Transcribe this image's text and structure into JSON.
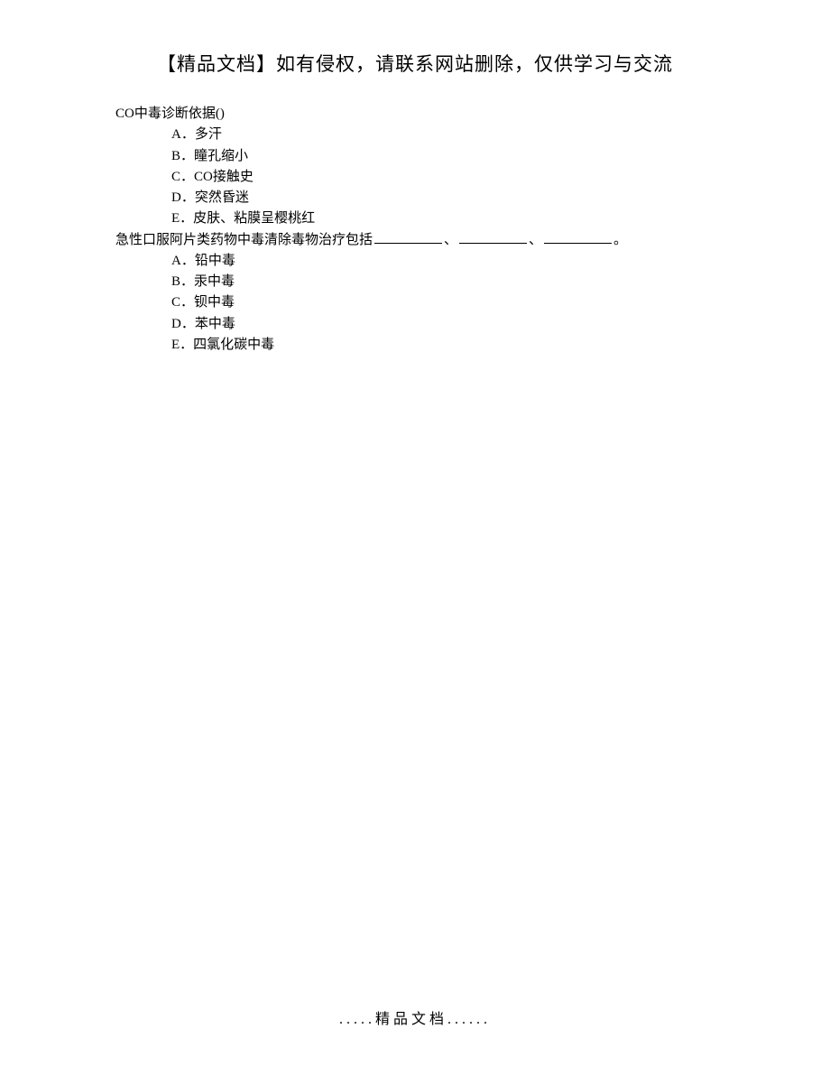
{
  "header": "【精品文档】如有侵权，请联系网站删除，仅供学习与交流",
  "questions": [
    {
      "text": "CO中毒诊断依据()",
      "options": [
        "A．多汗",
        "B．瞳孔缩小",
        "C．CO接触史",
        "D．突然昏迷",
        "E．皮肤、粘膜呈樱桃红"
      ]
    },
    {
      "text_prefix": "急性口服阿片类药物中毒清除毒物治疗包括",
      "text_sep": "、",
      "text_suffix": "。",
      "blanks_count": 3,
      "options": [
        "A．铅中毒",
        "B．汞中毒",
        "C．钡中毒",
        "D．苯中毒",
        "E．四氯化碳中毒"
      ]
    }
  ],
  "footer": ".....精品文档......"
}
